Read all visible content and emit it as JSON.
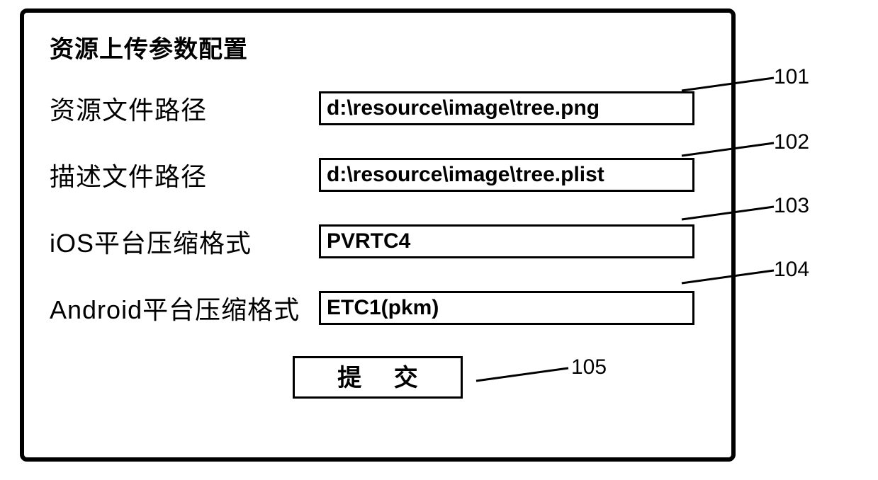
{
  "title": "资源上传参数配置",
  "fields": {
    "resource_path": {
      "label": "资源文件路径",
      "value": "d:\\resource\\image\\tree.png",
      "callout": "101"
    },
    "desc_path": {
      "label": "描述文件路径",
      "value": "d:\\resource\\image\\tree.plist",
      "callout": "102"
    },
    "ios_fmt": {
      "label": "iOS平台压缩格式",
      "value": "PVRTC4",
      "callout": "103"
    },
    "android_fmt": {
      "label": "Android平台压缩格式",
      "value": "ETC1(pkm)",
      "callout": "104"
    }
  },
  "submit": {
    "label": "提  交",
    "callout": "105"
  }
}
